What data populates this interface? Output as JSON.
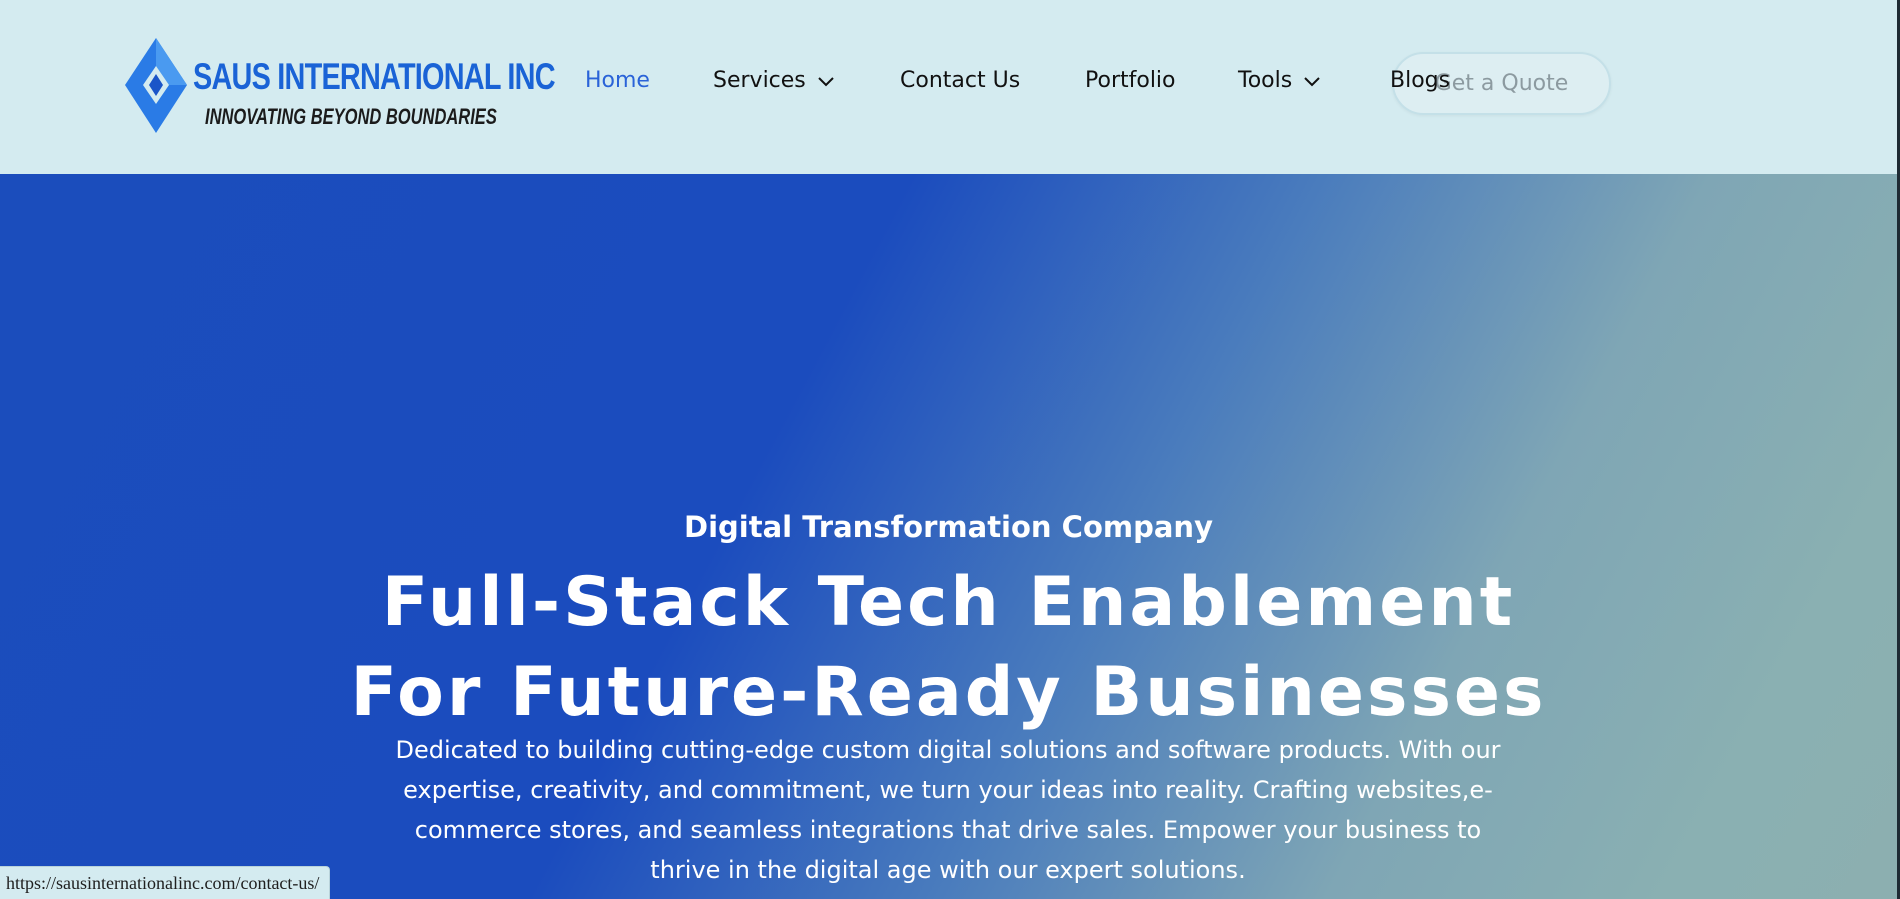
{
  "header": {
    "logo": {
      "title": "SAUS INTERNATIONAL INC",
      "tagline": "INNOVATING BEYOND BOUNDARIES",
      "brand_color": "#1a63d6"
    },
    "nav": [
      {
        "label": "Home",
        "active": true
      },
      {
        "label": "Services",
        "dropdown": true
      },
      {
        "label": "Contact Us"
      },
      {
        "label": "Portfolio"
      },
      {
        "label": "Tools",
        "dropdown": true
      },
      {
        "label": "Blogs"
      }
    ],
    "cta_label": "Get a Quote",
    "active_color": "#2a63d8",
    "background": "#d4ebf0"
  },
  "hero": {
    "subtitle": "Digital Transformation Company",
    "title_line1": "Full-Stack Tech Enablement",
    "title_line2": "For Future-Ready Businesses",
    "description": "Dedicated to building cutting-edge custom digital solutions and software products. With our expertise, creativity, and commitment, we turn your ideas into reality. Crafting websites,e-commerce stores, and seamless integrations that drive sales. Empower your business to thrive in the digital age with our expert solutions.",
    "gradient_start": "#1b4dbc",
    "gradient_end": "#8cafb0"
  },
  "status_bar": {
    "url": "https://sausinternationalinc.com/contact-us/"
  }
}
